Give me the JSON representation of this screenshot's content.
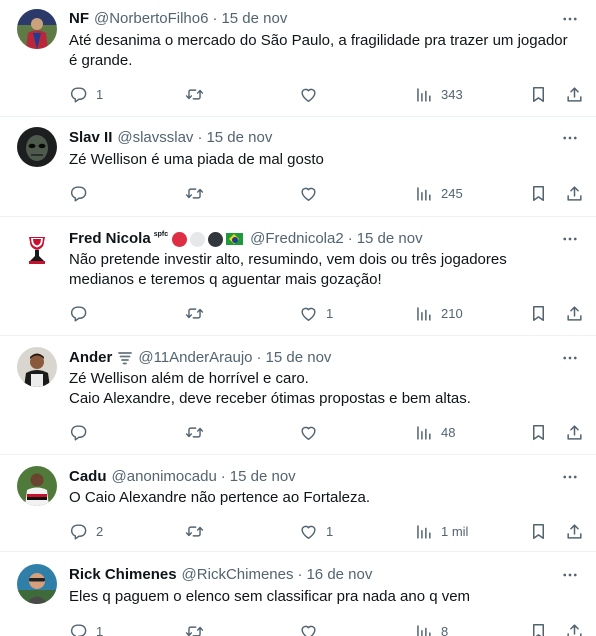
{
  "tweets": [
    {
      "name": "NF",
      "handle": "@NorbertoFilho6",
      "date": "15 de nov",
      "lines": [
        "Até desanima o mercado do São Paulo, a fragilidade pra trazer um jogador",
        "é grande."
      ],
      "replies": "1",
      "retweets": "",
      "likes": "",
      "views": "343"
    },
    {
      "name": "Slav II",
      "handle": "@slavsslav",
      "date": "15 de nov",
      "lines": [
        "Zé Wellison é uma piada de mal gosto"
      ],
      "replies": "",
      "retweets": "",
      "likes": "",
      "views": "245"
    },
    {
      "name": "Fred Nicola",
      "badge": "spfc",
      "handle": "@Frednicola2",
      "date": "15 de nov",
      "lines": [
        "Não pretende investir alto, resumindo, vem dois ou três jogadores",
        "medianos e teremos q aguentar mais gozação!"
      ],
      "replies": "",
      "retweets": "",
      "likes": "1",
      "views": "210"
    },
    {
      "name": "Ander",
      "badge_icon": "tornado-icon",
      "handle": "@11AnderAraujo",
      "date": "15 de nov",
      "lines": [
        "Zé Wellison além de horrível e caro.",
        "Caio Alexandre, deve receber ótimas propostas e bem altas."
      ],
      "replies": "",
      "retweets": "",
      "likes": "",
      "views": "48"
    },
    {
      "name": "Cadu",
      "handle": "@anonimocadu",
      "date": "15 de nov",
      "lines": [
        "O Caio Alexandre não pertence ao Fortaleza."
      ],
      "replies": "2",
      "retweets": "",
      "likes": "1",
      "views": "1 mil"
    },
    {
      "name": "Rick Chimenes",
      "handle": "@RickChimenes",
      "date": "16 de nov",
      "lines": [
        "Eles q paguem o elenco sem classificar pra nada ano q vem"
      ],
      "replies": "1",
      "retweets": "",
      "likes": "",
      "views": "8"
    }
  ],
  "icons": {
    "reply": "reply-icon",
    "retweet": "retweet-icon",
    "like": "like-icon",
    "views": "views-icon",
    "bookmark": "bookmark-icon",
    "share": "share-icon",
    "more": "more-icon"
  },
  "colors": {
    "text": "#0f1419",
    "secondary": "#536471",
    "divider": "#eff3f4",
    "emoji_red": "#dd2e44",
    "emoji_white": "#e6e7e8",
    "emoji_black": "#31373d"
  }
}
